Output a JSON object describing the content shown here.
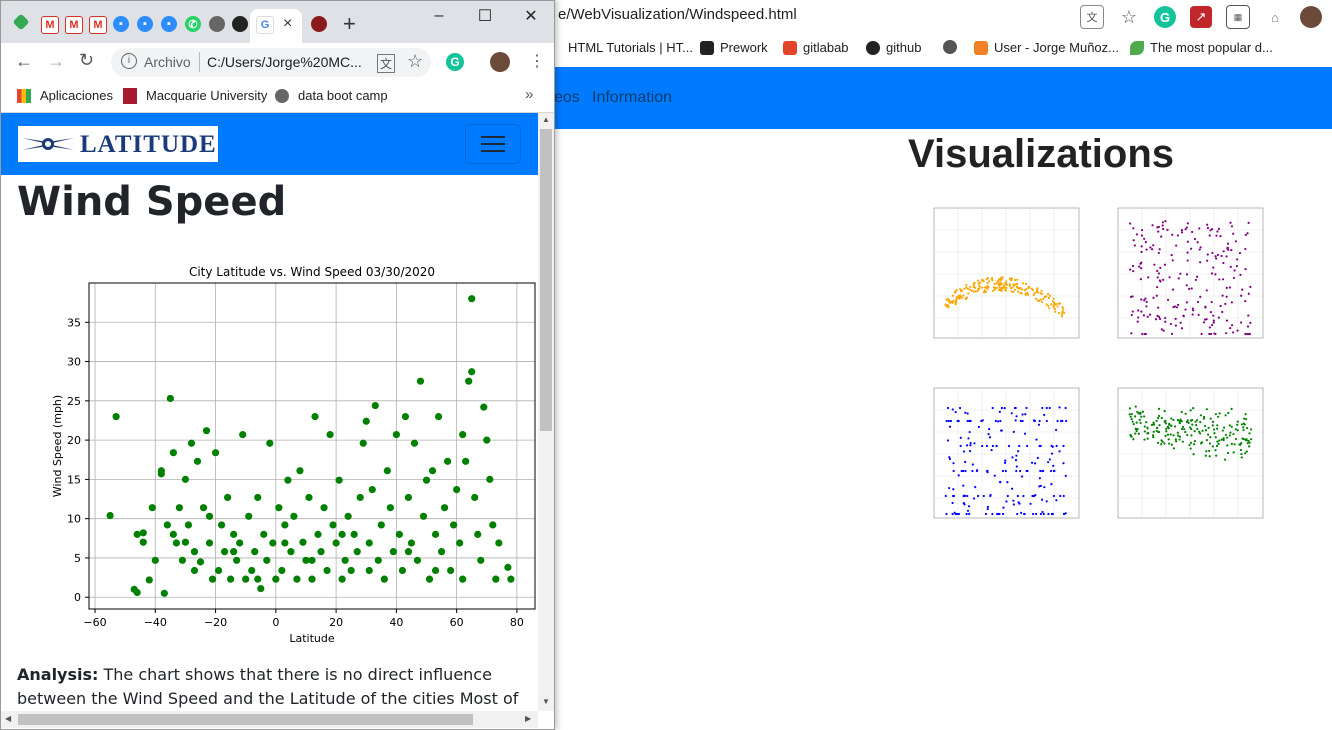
{
  "background_window": {
    "url": "e/WebVisualization/Windspeed.html",
    "bookmarks": [
      "HTML Tutorials | HT...",
      "Prework",
      "gitlabab",
      "github",
      "User - Jorge Muñoz...",
      "The most popular d..."
    ],
    "nav_items": [
      "eos",
      "Information"
    ],
    "visualizations_title": "Visualizations"
  },
  "foreground_window": {
    "tab_icons": [
      "zoom-icon",
      "gmail-icon",
      "gmail-icon",
      "gmail-icon",
      "zoom-icon",
      "zoom-icon",
      "zoom-icon",
      "whatsapp-icon",
      "globe-icon",
      "github-icon",
      "google-icon",
      "university-icon"
    ],
    "new_tab": "+",
    "close_tab": "×",
    "archivo_label": "Archivo",
    "url": "C:/Users/Jorge%20MC...",
    "bookmarks": [
      "Aplicaciones",
      "Macquarie University",
      "data boot camp"
    ],
    "bookmarks_more": "»",
    "logo_text": "LATITUDE",
    "heading": "Wind Speed",
    "analysis_label": "Analysis:",
    "analysis_text": " The chart shows that there is no direct influence between the Wind Speed and the Latitude of the cities Most of cities had a wind"
  },
  "colors": {
    "nav_blue": "#007bff",
    "marker_green": "#008000",
    "thumb_orange": "#ffa500",
    "thumb_purple": "#800080",
    "thumb_blue": "#0000ff"
  },
  "chart_data": {
    "type": "scatter",
    "title": "City Latitude vs. Wind Speed 03/30/2020",
    "xlabel": "Latitude",
    "ylabel": "Wind Speed (mph)",
    "xlim": [
      -62,
      86
    ],
    "ylim": [
      -1.5,
      40
    ],
    "xticks": [
      -60,
      -40,
      -20,
      0,
      20,
      40,
      60,
      80
    ],
    "yticks": [
      0,
      5,
      10,
      15,
      20,
      25,
      30,
      35
    ],
    "grid": true,
    "color": "#008000",
    "points": [
      [
        -55,
        10.4
      ],
      [
        -53,
        23.0
      ],
      [
        -47,
        1.0
      ],
      [
        -46,
        0.6
      ],
      [
        -46,
        8.0
      ],
      [
        -44,
        7.0
      ],
      [
        -44,
        8.2
      ],
      [
        -42,
        2.2
      ],
      [
        -41,
        11.4
      ],
      [
        -40,
        4.7
      ],
      [
        -38,
        16.1
      ],
      [
        -38,
        15.7
      ],
      [
        -37,
        0.5
      ],
      [
        -36,
        9.2
      ],
      [
        -35,
        25.3
      ],
      [
        -34,
        18.4
      ],
      [
        -34,
        8.0
      ],
      [
        -33,
        6.9
      ],
      [
        -32,
        11.4
      ],
      [
        -31,
        4.7
      ],
      [
        -30,
        15.0
      ],
      [
        -29,
        9.2
      ],
      [
        -28,
        19.6
      ],
      [
        -27,
        5.8
      ],
      [
        -26,
        17.3
      ],
      [
        -25,
        4.5
      ],
      [
        -24,
        11.4
      ],
      [
        -23,
        21.2
      ],
      [
        -22,
        6.9
      ],
      [
        -21,
        2.3
      ],
      [
        -20,
        18.4
      ],
      [
        -19,
        3.4
      ],
      [
        -18,
        9.2
      ],
      [
        -17,
        5.8
      ],
      [
        -16,
        12.7
      ],
      [
        -15,
        2.3
      ],
      [
        -14,
        8.0
      ],
      [
        -13,
        4.7
      ],
      [
        -12,
        6.9
      ],
      [
        -11,
        20.7
      ],
      [
        -10,
        2.3
      ],
      [
        -9,
        10.3
      ],
      [
        -8,
        3.4
      ],
      [
        -7,
        5.8
      ],
      [
        -6,
        12.7
      ],
      [
        -5,
        1.1
      ],
      [
        -4,
        8.0
      ],
      [
        -3,
        4.7
      ],
      [
        -2,
        19.6
      ],
      [
        -1,
        6.9
      ],
      [
        0,
        2.3
      ],
      [
        1,
        11.4
      ],
      [
        2,
        3.4
      ],
      [
        3,
        9.2
      ],
      [
        4,
        14.9
      ],
      [
        5,
        5.8
      ],
      [
        6,
        10.3
      ],
      [
        7,
        2.3
      ],
      [
        8,
        16.1
      ],
      [
        9,
        7.0
      ],
      [
        10,
        4.7
      ],
      [
        11,
        12.7
      ],
      [
        12,
        2.3
      ],
      [
        13,
        23.0
      ],
      [
        14,
        8.0
      ],
      [
        15,
        5.8
      ],
      [
        16,
        11.4
      ],
      [
        17,
        3.4
      ],
      [
        18,
        20.7
      ],
      [
        19,
        9.2
      ],
      [
        20,
        6.9
      ],
      [
        21,
        14.9
      ],
      [
        22,
        2.3
      ],
      [
        23,
        4.7
      ],
      [
        24,
        10.3
      ],
      [
        25,
        3.4
      ],
      [
        26,
        8.0
      ],
      [
        27,
        5.8
      ],
      [
        28,
        12.7
      ],
      [
        29,
        19.6
      ],
      [
        30,
        22.4
      ],
      [
        31,
        6.9
      ],
      [
        32,
        13.7
      ],
      [
        33,
        24.4
      ],
      [
        34,
        4.7
      ],
      [
        35,
        9.2
      ],
      [
        36,
        2.3
      ],
      [
        37,
        16.1
      ],
      [
        38,
        11.4
      ],
      [
        39,
        5.8
      ],
      [
        40,
        20.7
      ],
      [
        41,
        8.0
      ],
      [
        42,
        3.4
      ],
      [
        43,
        23.0
      ],
      [
        44,
        12.7
      ],
      [
        45,
        6.9
      ],
      [
        46,
        19.6
      ],
      [
        47,
        4.7
      ],
      [
        48,
        27.5
      ],
      [
        49,
        10.3
      ],
      [
        50,
        14.9
      ],
      [
        51,
        2.3
      ],
      [
        52,
        16.1
      ],
      [
        53,
        8.0
      ],
      [
        54,
        23.0
      ],
      [
        55,
        5.8
      ],
      [
        56,
        11.4
      ],
      [
        57,
        17.3
      ],
      [
        58,
        3.4
      ],
      [
        59,
        9.2
      ],
      [
        60,
        13.7
      ],
      [
        61,
        6.9
      ],
      [
        62,
        20.7
      ],
      [
        63,
        17.3
      ],
      [
        64,
        27.5
      ],
      [
        65,
        38.0
      ],
      [
        65,
        28.7
      ],
      [
        66,
        12.7
      ],
      [
        67,
        8.0
      ],
      [
        68,
        4.7
      ],
      [
        69,
        24.2
      ],
      [
        70,
        20.0
      ],
      [
        71,
        15.0
      ],
      [
        72,
        9.2
      ],
      [
        73,
        2.3
      ],
      [
        74,
        6.9
      ],
      [
        77,
        3.8
      ],
      [
        78,
        2.3
      ],
      [
        -30,
        7.0
      ],
      [
        -27,
        3.4
      ],
      [
        -22,
        10.3
      ],
      [
        -14,
        5.8
      ],
      [
        -6,
        2.3
      ],
      [
        3,
        6.9
      ],
      [
        12,
        4.7
      ],
      [
        22,
        8.0
      ],
      [
        31,
        3.4
      ],
      [
        44,
        5.8
      ],
      [
        53,
        3.4
      ],
      [
        62,
        2.3
      ]
    ]
  }
}
